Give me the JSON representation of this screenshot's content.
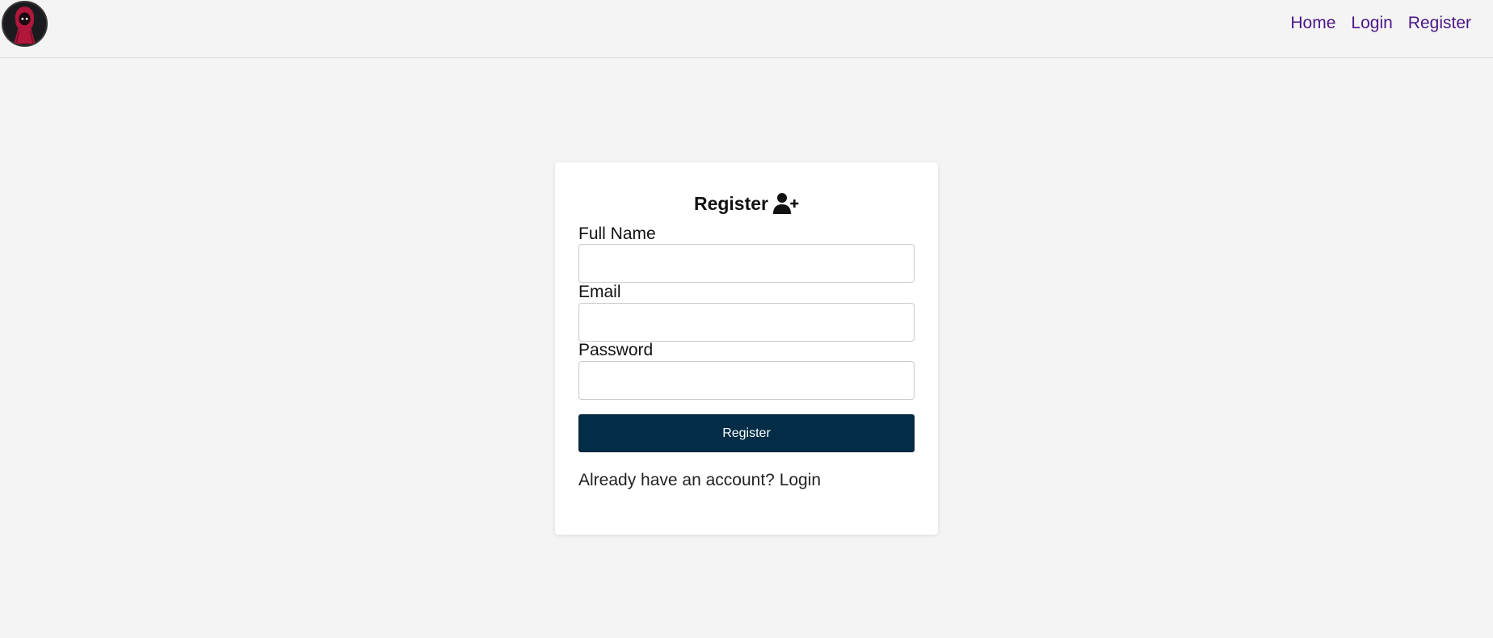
{
  "nav": {
    "logo_icon": "hooded-figure-icon",
    "links": [
      {
        "label": "Home"
      },
      {
        "label": "Login"
      },
      {
        "label": "Register"
      }
    ],
    "link_color": "#4b1587"
  },
  "form": {
    "title": "Register",
    "title_icon": "user-plus-icon",
    "fields": [
      {
        "label": "Full Name",
        "value": ""
      },
      {
        "label": "Email",
        "value": ""
      },
      {
        "label": "Password",
        "value": ""
      }
    ],
    "submit_label": "Register",
    "submit_color": "#022d47",
    "footer_prompt": "Already have an account?",
    "footer_link": "Login"
  }
}
